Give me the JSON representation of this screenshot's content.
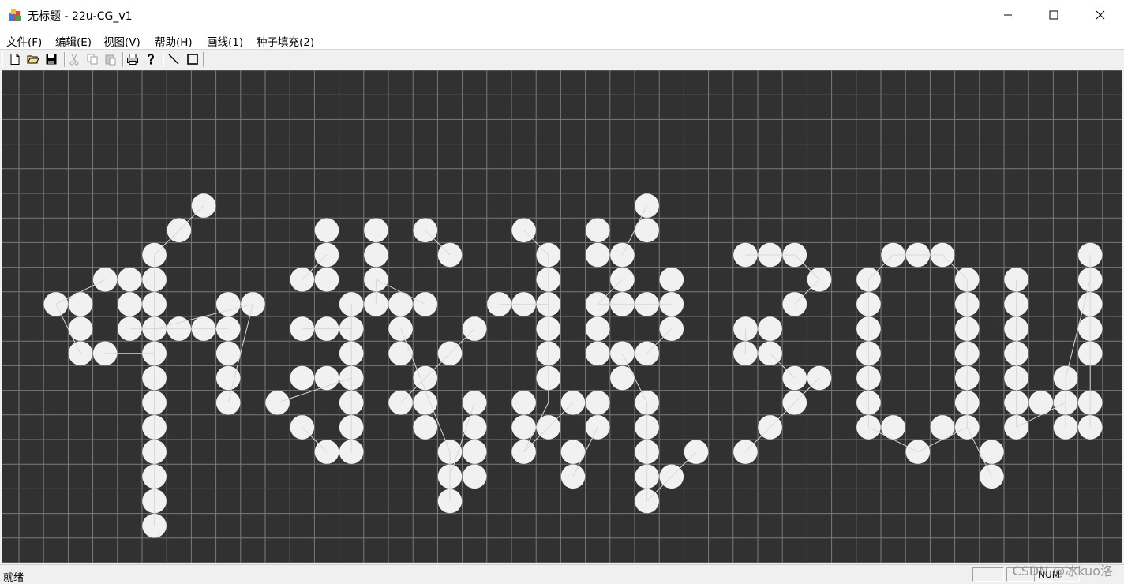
{
  "window": {
    "title": "无标题 - 22u-CG_v1",
    "controls": [
      "minimize",
      "maximize",
      "close"
    ]
  },
  "menu": {
    "items": [
      "文件(F)",
      "编辑(E)",
      "视图(V)",
      "帮助(H)",
      "画线(1)",
      "种子填充(2)"
    ]
  },
  "toolbar": {
    "buttons": [
      {
        "icon": "new-file-icon",
        "enabled": true
      },
      {
        "icon": "open-folder-icon",
        "enabled": true
      },
      {
        "icon": "save-icon",
        "enabled": true
      },
      {
        "icon": "cut-icon",
        "enabled": false
      },
      {
        "icon": "copy-icon",
        "enabled": false
      },
      {
        "icon": "paste-icon",
        "enabled": false
      },
      {
        "icon": "print-icon",
        "enabled": true
      },
      {
        "icon": "help-icon",
        "enabled": true
      },
      {
        "icon": "line-tool-icon",
        "enabled": true
      },
      {
        "icon": "rectangle-tool-icon",
        "enabled": true
      }
    ]
  },
  "status": {
    "text": "就绪",
    "num": "NUM",
    "watermark": "CSDN @冰kuo洛"
  },
  "colors": {
    "canvas_bg": "#313131",
    "grid_line": "#7a7a7a",
    "pixel_fill": "#f1f1f1",
    "segment": "#d8d8d8"
  },
  "pixels": [
    [
      7,
      5
    ],
    [
      6,
      6
    ],
    [
      5,
      7
    ],
    [
      3,
      8
    ],
    [
      4,
      8
    ],
    [
      5,
      8
    ],
    [
      1,
      9
    ],
    [
      2,
      9
    ],
    [
      4,
      9
    ],
    [
      5,
      9
    ],
    [
      8,
      9
    ],
    [
      9,
      9
    ],
    [
      2,
      10
    ],
    [
      4,
      10
    ],
    [
      5,
      10
    ],
    [
      6,
      10
    ],
    [
      7,
      10
    ],
    [
      8,
      10
    ],
    [
      2,
      11
    ],
    [
      3,
      11
    ],
    [
      5,
      11
    ],
    [
      8,
      11
    ],
    [
      5,
      12
    ],
    [
      8,
      12
    ],
    [
      5,
      13
    ],
    [
      8,
      13
    ],
    [
      5,
      14
    ],
    [
      5,
      15
    ],
    [
      5,
      16
    ],
    [
      5,
      17
    ],
    [
      5,
      18
    ],
    [
      12,
      6
    ],
    [
      14,
      6
    ],
    [
      16,
      6
    ],
    [
      12,
      7
    ],
    [
      14,
      7
    ],
    [
      17,
      7
    ],
    [
      11,
      8
    ],
    [
      12,
      8
    ],
    [
      14,
      8
    ],
    [
      13,
      9
    ],
    [
      14,
      9
    ],
    [
      15,
      9
    ],
    [
      16,
      9
    ],
    [
      11,
      10
    ],
    [
      12,
      10
    ],
    [
      13,
      10
    ],
    [
      15,
      10
    ],
    [
      18,
      10
    ],
    [
      13,
      11
    ],
    [
      15,
      11
    ],
    [
      17,
      11
    ],
    [
      11,
      12
    ],
    [
      12,
      12
    ],
    [
      13,
      12
    ],
    [
      16,
      12
    ],
    [
      10,
      13
    ],
    [
      13,
      13
    ],
    [
      15,
      13
    ],
    [
      16,
      13
    ],
    [
      18,
      13
    ],
    [
      11,
      14
    ],
    [
      13,
      14
    ],
    [
      16,
      14
    ],
    [
      18,
      14
    ],
    [
      12,
      15
    ],
    [
      13,
      15
    ],
    [
      17,
      15
    ],
    [
      18,
      15
    ],
    [
      17,
      16
    ],
    [
      18,
      16
    ],
    [
      17,
      17
    ],
    [
      20,
      6
    ],
    [
      23,
      6
    ],
    [
      25,
      5
    ],
    [
      21,
      7
    ],
    [
      23,
      7
    ],
    [
      24,
      7
    ],
    [
      25,
      6
    ],
    [
      21,
      8
    ],
    [
      24,
      8
    ],
    [
      26,
      8
    ],
    [
      19,
      9
    ],
    [
      20,
      9
    ],
    [
      21,
      9
    ],
    [
      23,
      9
    ],
    [
      24,
      9
    ],
    [
      25,
      9
    ],
    [
      26,
      9
    ],
    [
      21,
      10
    ],
    [
      23,
      10
    ],
    [
      26,
      10
    ],
    [
      21,
      11
    ],
    [
      23,
      11
    ],
    [
      24,
      11
    ],
    [
      25,
      11
    ],
    [
      21,
      12
    ],
    [
      24,
      12
    ],
    [
      20,
      13
    ],
    [
      22,
      13
    ],
    [
      23,
      13
    ],
    [
      25,
      13
    ],
    [
      20,
      14
    ],
    [
      21,
      14
    ],
    [
      23,
      14
    ],
    [
      25,
      14
    ],
    [
      20,
      15
    ],
    [
      22,
      15
    ],
    [
      25,
      15
    ],
    [
      27,
      15
    ],
    [
      22,
      16
    ],
    [
      25,
      16
    ],
    [
      26,
      16
    ],
    [
      25,
      17
    ],
    [
      29,
      7
    ],
    [
      30,
      7
    ],
    [
      31,
      7
    ],
    [
      32,
      8
    ],
    [
      31,
      9
    ],
    [
      29,
      10
    ],
    [
      30,
      10
    ],
    [
      29,
      11
    ],
    [
      30,
      11
    ],
    [
      31,
      12
    ],
    [
      32,
      12
    ],
    [
      31,
      13
    ],
    [
      30,
      14
    ],
    [
      29,
      15
    ],
    [
      35,
      7
    ],
    [
      36,
      7
    ],
    [
      37,
      7
    ],
    [
      34,
      8
    ],
    [
      38,
      8
    ],
    [
      34,
      9
    ],
    [
      38,
      9
    ],
    [
      34,
      10
    ],
    [
      38,
      10
    ],
    [
      34,
      11
    ],
    [
      38,
      11
    ],
    [
      34,
      12
    ],
    [
      38,
      12
    ],
    [
      34,
      13
    ],
    [
      38,
      13
    ],
    [
      34,
      14
    ],
    [
      35,
      14
    ],
    [
      37,
      14
    ],
    [
      38,
      14
    ],
    [
      36,
      15
    ],
    [
      39,
      15
    ],
    [
      39,
      16
    ],
    [
      43,
      7
    ],
    [
      40,
      8
    ],
    [
      43,
      8
    ],
    [
      40,
      9
    ],
    [
      43,
      9
    ],
    [
      40,
      10
    ],
    [
      43,
      10
    ],
    [
      40,
      11
    ],
    [
      43,
      11
    ],
    [
      40,
      12
    ],
    [
      42,
      12
    ],
    [
      40,
      13
    ],
    [
      41,
      13
    ],
    [
      42,
      13
    ],
    [
      43,
      13
    ],
    [
      40,
      14
    ],
    [
      42,
      14
    ],
    [
      43,
      14
    ]
  ],
  "segments": [
    [
      [
        7,
        5
      ],
      [
        5,
        7
      ]
    ],
    [
      [
        1,
        9
      ],
      [
        3,
        8
      ]
    ],
    [
      [
        1,
        9
      ],
      [
        2,
        11
      ]
    ],
    [
      [
        3,
        11
      ],
      [
        5,
        11
      ]
    ],
    [
      [
        5,
        7
      ],
      [
        5,
        18
      ]
    ],
    [
      [
        4,
        10
      ],
      [
        8,
        10
      ]
    ],
    [
      [
        5,
        10
      ],
      [
        9,
        9
      ]
    ],
    [
      [
        9,
        9
      ],
      [
        8,
        13
      ]
    ],
    [
      [
        12,
        7
      ],
      [
        11,
        8
      ]
    ],
    [
      [
        11,
        10
      ],
      [
        13,
        10
      ]
    ],
    [
      [
        13,
        9
      ],
      [
        13,
        15
      ]
    ],
    [
      [
        10,
        13
      ],
      [
        13,
        12
      ]
    ],
    [
      [
        11,
        14
      ],
      [
        12,
        15
      ]
    ],
    [
      [
        14,
        8
      ],
      [
        14,
        9
      ]
    ],
    [
      [
        14,
        8
      ],
      [
        16,
        9
      ]
    ],
    [
      [
        15,
        10
      ],
      [
        17,
        15
      ]
    ],
    [
      [
        16,
        6
      ],
      [
        17,
        7
      ]
    ],
    [
      [
        18,
        10
      ],
      [
        15,
        13
      ]
    ],
    [
      [
        17,
        15
      ],
      [
        17,
        17
      ]
    ],
    [
      [
        18,
        13
      ],
      [
        17,
        16
      ]
    ],
    [
      [
        20,
        6
      ],
      [
        21,
        7
      ]
    ],
    [
      [
        19,
        9
      ],
      [
        21,
        9
      ]
    ],
    [
      [
        21,
        7
      ],
      [
        21,
        13
      ]
    ],
    [
      [
        21,
        13
      ],
      [
        20,
        15
      ]
    ],
    [
      [
        20,
        15
      ],
      [
        22,
        13
      ]
    ],
    [
      [
        25,
        5
      ],
      [
        24,
        7
      ]
    ],
    [
      [
        24,
        8
      ],
      [
        23,
        9
      ]
    ],
    [
      [
        23,
        9
      ],
      [
        26,
        9
      ]
    ],
    [
      [
        26,
        10
      ],
      [
        25,
        11
      ]
    ],
    [
      [
        24,
        11
      ],
      [
        25,
        13
      ]
    ],
    [
      [
        25,
        13
      ],
      [
        25,
        17
      ]
    ],
    [
      [
        27,
        15
      ],
      [
        25,
        17
      ]
    ],
    [
      [
        23,
        14
      ],
      [
        22,
        16
      ]
    ],
    [
      [
        29,
        7
      ],
      [
        31,
        7
      ]
    ],
    [
      [
        31,
        7
      ],
      [
        32,
        8
      ]
    ],
    [
      [
        32,
        8
      ],
      [
        31,
        9
      ]
    ],
    [
      [
        29,
        10
      ],
      [
        29,
        11
      ]
    ],
    [
      [
        30,
        11
      ],
      [
        31,
        12
      ]
    ],
    [
      [
        32,
        12
      ],
      [
        29,
        15
      ]
    ],
    [
      [
        34,
        8
      ],
      [
        35,
        7
      ]
    ],
    [
      [
        35,
        7
      ],
      [
        37,
        7
      ]
    ],
    [
      [
        37,
        7
      ],
      [
        38,
        8
      ]
    ],
    [
      [
        34,
        8
      ],
      [
        34,
        14
      ]
    ],
    [
      [
        34,
        14
      ],
      [
        36,
        15
      ]
    ],
    [
      [
        36,
        15
      ],
      [
        38,
        14
      ]
    ],
    [
      [
        38,
        8
      ],
      [
        38,
        14
      ]
    ],
    [
      [
        38,
        14
      ],
      [
        39,
        16
      ]
    ],
    [
      [
        40,
        8
      ],
      [
        40,
        14
      ]
    ],
    [
      [
        40,
        14
      ],
      [
        42,
        13
      ]
    ],
    [
      [
        42,
        12
      ],
      [
        42,
        14
      ]
    ],
    [
      [
        42,
        12
      ],
      [
        43,
        8
      ]
    ],
    [
      [
        43,
        7
      ],
      [
        43,
        14
      ]
    ]
  ]
}
